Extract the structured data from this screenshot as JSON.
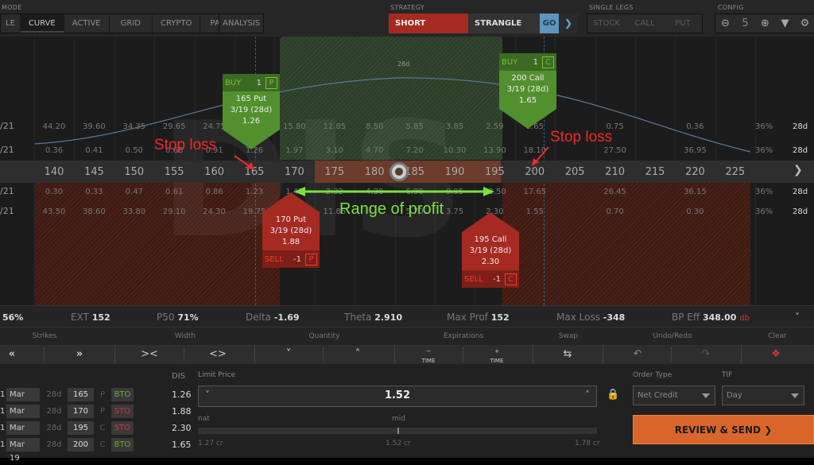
{
  "topbar": {
    "mode_label": "MODE",
    "tabs": [
      "LE",
      "CURVE",
      "ACTIVE",
      "GRID",
      "CRYPTO",
      "PAIRS"
    ],
    "analysis": "ANALYSIS",
    "strategy_label": "STRATEGY",
    "strategy_side": "SHORT",
    "strategy_type": "STRANGLE",
    "go": "GO",
    "single_legs_label": "SINGLE LEGS",
    "single_legs": [
      "STOCK",
      "CALL",
      "PUT"
    ],
    "config_label": "CONFIG",
    "config_value": "5"
  },
  "chart": {
    "curve_label": "28d",
    "strikes": [
      "140",
      "145",
      "150",
      "155",
      "160",
      "165",
      "170",
      "175",
      "180",
      "185",
      "190",
      "195",
      "200",
      "205",
      "210",
      "215",
      "220",
      "225"
    ],
    "row_labels": [
      "/21",
      "/21",
      "/21",
      "/21"
    ],
    "call_prices": [
      "44.20",
      "39.60",
      "34.35",
      "29.65",
      "24.75",
      "",
      "15.80",
      "11.85",
      "8.50",
      "5.85",
      "3.85",
      "2.59",
      "1.65",
      "",
      "0.75",
      "",
      "0.36",
      ""
    ],
    "put_prices": [
      "0.36",
      "0.41",
      "0.50",
      "0.68",
      "0.91",
      "1.26",
      "1.97",
      "3.10",
      "4.70",
      "7.20",
      "10.30",
      "13.90",
      "18.10",
      "",
      "27.50",
      "",
      "36.95",
      ""
    ],
    "put_prices_b": [
      "0.30",
      "0.33",
      "0.47",
      "0.61",
      "0.86",
      "1.23",
      "1.45",
      "2.32",
      "4.30",
      "6.90",
      "9.95",
      "13.50",
      "17.65",
      "",
      "26.45",
      "",
      "36.15",
      ""
    ],
    "call_prices_b": [
      "43.50",
      "38.60",
      "33.80",
      "29.10",
      "24.30",
      "19.75",
      "",
      "11.85",
      "",
      "5.70",
      "3.75",
      "2.30",
      "1.55",
      "",
      "0.70",
      "",
      "0.30",
      ""
    ],
    "iv": [
      "36%",
      "36%",
      "36%",
      "36%"
    ],
    "dte": [
      "28d",
      "28d",
      "28d",
      "28d"
    ],
    "tickets": [
      {
        "side": "BUY",
        "qty": "1",
        "type": "P",
        "line1": "165 Put",
        "line2": "3/19 (28d)",
        "line3": "1.26"
      },
      {
        "side": "BUY",
        "qty": "1",
        "type": "C",
        "line1": "200 Call",
        "line2": "3/19 (28d)",
        "line3": "1.65"
      },
      {
        "side": "SELL",
        "qty": "-1",
        "type": "P",
        "line1": "170 Put",
        "line2": "3/19 (28d)",
        "line3": "1.88"
      },
      {
        "side": "SELL",
        "qty": "-1",
        "type": "C",
        "line1": "195 Call",
        "line2": "3/19 (28d)",
        "line3": "2.30"
      }
    ],
    "annotations": {
      "stop_loss_left": "Stop loss",
      "stop_loss_right": "Stop loss",
      "range": "Range of profit"
    }
  },
  "stats": {
    "pop": "56%",
    "ext_label": "EXT",
    "ext": "152",
    "p50_label": "P50",
    "p50": "71%",
    "delta_label": "Delta",
    "delta": "-1.69",
    "theta_label": "Theta",
    "theta": "2.910",
    "maxprof_label": "Max Prof",
    "maxprof": "152",
    "maxloss_label": "Max Loss",
    "maxloss": "-348",
    "bpeff_label": "BP Eff",
    "bpeff": "348.00",
    "bpeff_unit": "db"
  },
  "controls": {
    "labels": [
      "Strikes",
      "Width",
      "Quantity",
      "Expirations",
      "Swap",
      "Undo/Redo",
      "Clear"
    ],
    "time_label": "TIME"
  },
  "order": {
    "symbol": "DIS",
    "legs": [
      {
        "qty": "1",
        "date": "Mar 19",
        "dte": "28d",
        "strike": "165",
        "pc": "P",
        "action": "BTO",
        "price": "1.26"
      },
      {
        "qty": "1",
        "date": "Mar 19",
        "dte": "28d",
        "strike": "170",
        "pc": "P",
        "action": "STO",
        "price": "1.88"
      },
      {
        "qty": "1",
        "date": "Mar 19",
        "dte": "28d",
        "strike": "195",
        "pc": "C",
        "action": "STO",
        "price": "2.30"
      },
      {
        "qty": "1",
        "date": "Mar 19",
        "dte": "28d",
        "strike": "200",
        "pc": "C",
        "action": "BTO",
        "price": "1.65"
      }
    ],
    "limit_label": "Limit Price",
    "limit_value": "1.52",
    "nat_label": "nat",
    "mid_label": "mid",
    "nat_value": "1.27 cr",
    "mid_value": "1.52 cr",
    "far_value": "1.78 cr",
    "order_type_label": "Order Type",
    "order_type": "Net Credit",
    "tif_label": "TIF",
    "tif": "Day",
    "review": "REVIEW & SEND"
  },
  "colors": {
    "buy": "#52902e",
    "sell": "#a52a22",
    "accent": "#d8662a",
    "go": "#5f94bd"
  }
}
